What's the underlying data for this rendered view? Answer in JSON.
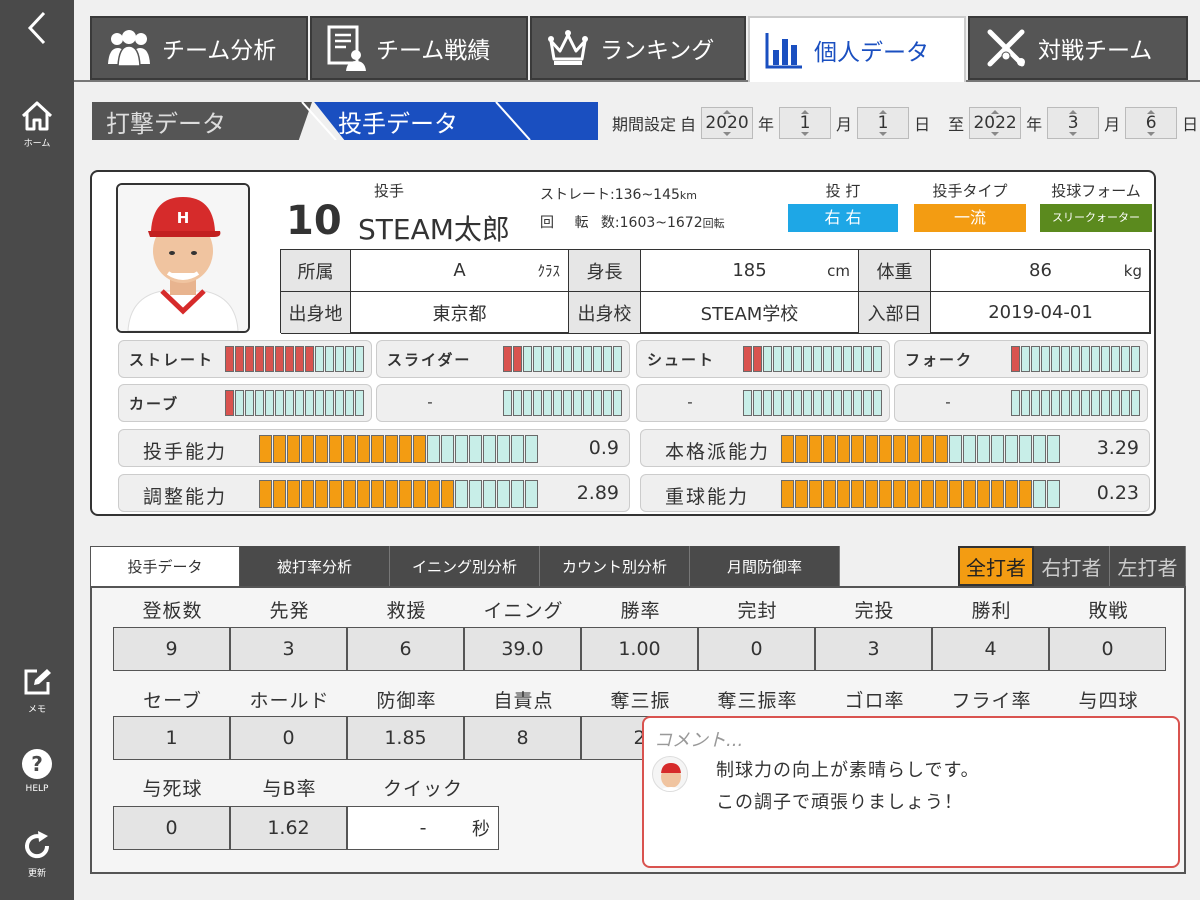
{
  "sidebar": {
    "back": "<",
    "home": "ホーム",
    "memo": "メモ",
    "help": "HELP",
    "refresh": "更新"
  },
  "tabs": [
    {
      "label": "チーム分析",
      "icon": "team-icon"
    },
    {
      "label": "チーム戦績",
      "icon": "report-icon"
    },
    {
      "label": "ランキング",
      "icon": "crown-icon"
    },
    {
      "label": "個人データ",
      "icon": "bar-chart-icon"
    },
    {
      "label": "対戦チーム",
      "icon": "crossed-bats-icon"
    }
  ],
  "segments": {
    "batting": "打撃データ",
    "pitching": "投手データ"
  },
  "period": {
    "label": "期間設定",
    "from": "自",
    "to": "至",
    "start": {
      "year": "2020",
      "month": "1",
      "day": "1"
    },
    "end": {
      "year": "2022",
      "month": "3",
      "day": "6"
    },
    "u_year": "年",
    "u_month": "月",
    "u_day": "日"
  },
  "player": {
    "number": "10",
    "name": "STEAM太郎",
    "position": "投手",
    "straight_label": "ストレート:",
    "straight_value": "136~145",
    "straight_unit": "km",
    "spin_label1": "回",
    "spin_label2": "転",
    "spin_label3": "数:",
    "spin_value": "1603~1672",
    "spin_unit": "回転",
    "throw_bat_label": "投 打",
    "throw_bat": "右 右",
    "type_label": "投手タイプ",
    "type": "一流",
    "form_label": "投球フォーム",
    "form": "スリークォーター"
  },
  "info": {
    "team_label": "所属",
    "team": "A",
    "team_unit": "ｸﾗｽ",
    "height_label": "身長",
    "height": "185",
    "height_unit": "cm",
    "weight_label": "体重",
    "weight": "86",
    "weight_unit": "kg",
    "hometown_label": "出身地",
    "hometown": "東京都",
    "school_label": "出身校",
    "school": "STEAM学校",
    "join_label": "入部日",
    "join": "2019-04-01"
  },
  "pitches": [
    {
      "label": "ストレート",
      "level": 0.67,
      "total": 14
    },
    {
      "label": "スライダー",
      "level": 0.17,
      "total": 12
    },
    {
      "label": "シュート",
      "level": 0.14,
      "total": 14
    },
    {
      "label": "フォーク",
      "level": 0.08,
      "total": 13
    },
    {
      "label": "カーブ",
      "level": 0.07,
      "total": 14
    },
    {
      "label": "-",
      "level": 0,
      "total": 12
    },
    {
      "label": "-",
      "level": 0,
      "total": 14
    },
    {
      "label": "-",
      "level": 0,
      "total": 13
    }
  ],
  "abilities": [
    {
      "label": "投手能力",
      "value": "0.9",
      "level": 0.6
    },
    {
      "label": "本格派能力",
      "value": "3.29",
      "level": 0.6
    },
    {
      "label": "調整能力",
      "value": "2.89",
      "level": 0.7
    },
    {
      "label": "重球能力",
      "value": "0.23",
      "level": 0.9
    }
  ],
  "subtabs": [
    "投手データ",
    "被打率分析",
    "イニング別分析",
    "カウント別分析",
    "月間防御率"
  ],
  "filters": [
    "全打者",
    "右打者",
    "左打者"
  ],
  "stats_row1": {
    "headers": [
      "登板数",
      "先発",
      "救援",
      "イニング",
      "勝率",
      "完封",
      "完投",
      "勝利",
      "敗戦"
    ],
    "values": [
      "9",
      "3",
      "6",
      "39.0",
      "1.00",
      "0",
      "3",
      "4",
      "0"
    ]
  },
  "stats_row2": {
    "headers": [
      "セーブ",
      "ホールド",
      "防御率",
      "自責点",
      "奪三振",
      "奪三振率",
      "ゴロ率",
      "フライ率",
      "与四球"
    ],
    "values": [
      "1",
      "0",
      "1.85",
      "8",
      "2"
    ]
  },
  "stats_row3": {
    "headers": [
      "与死球",
      "与B率",
      "クイック"
    ],
    "values": [
      "0",
      "1.62",
      "-"
    ],
    "quick_unit": "秒"
  },
  "comment": {
    "placeholder": "コメント...",
    "line1": "制球力の向上が素晴らしです。",
    "line2": "この調子で頑張りましょう！"
  },
  "colors": {
    "accent": "#1a4fc0",
    "pitch_fill": "#d9534f",
    "pitch_empty": "#c8eee8",
    "ability_fill": "#f39c12",
    "ability_empty": "#c8eee8",
    "type_badge": "#f39c12",
    "form_badge": "#5b8a1e",
    "throw_badge": "#1ea7e6"
  }
}
